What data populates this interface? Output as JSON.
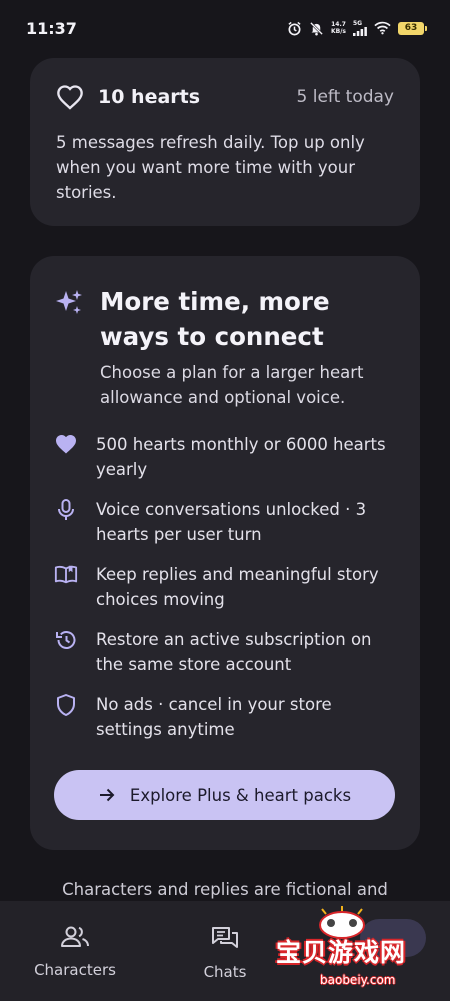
{
  "status_bar": {
    "time": "11:37",
    "net_speed_value": "14.7",
    "net_speed_unit": "KB/s",
    "signal_label": "5G",
    "battery": "63"
  },
  "hearts_card": {
    "count_label": "10 hearts",
    "left_today": "5 left today",
    "description": "5 messages refresh daily. Top up only when you want more time with your stories."
  },
  "plan_card": {
    "title": "More time, more ways to connect",
    "subtitle": "Choose a plan for a larger heart allowance and optional voice.",
    "features": [
      {
        "icon": "heart-icon",
        "text": "500 hearts monthly or 6000 hearts yearly"
      },
      {
        "icon": "microphone-icon",
        "text": "Voice conversations unlocked · 3 hearts per user turn"
      },
      {
        "icon": "book-icon",
        "text": "Keep replies and meaningful story choices moving"
      },
      {
        "icon": "restore-icon",
        "text": "Restore an active subscription on the same store account"
      },
      {
        "icon": "shield-icon",
        "text": "No ads · cancel in your store settings anytime"
      }
    ],
    "cta_label": "Explore Plus & heart packs"
  },
  "footer_note": "Characters and replies are fictional and",
  "bottom_nav": {
    "items": [
      {
        "label": "Characters",
        "icon": "people-icon"
      },
      {
        "label": "Chats",
        "icon": "chat-icon"
      }
    ]
  },
  "watermark": {
    "text": "宝贝游戏网",
    "url": "baobeiy.com"
  },
  "colors": {
    "background": "#17161b",
    "card": "#26252c",
    "accent": "#c9c3f3",
    "icon_accent": "#b9b2f2"
  }
}
